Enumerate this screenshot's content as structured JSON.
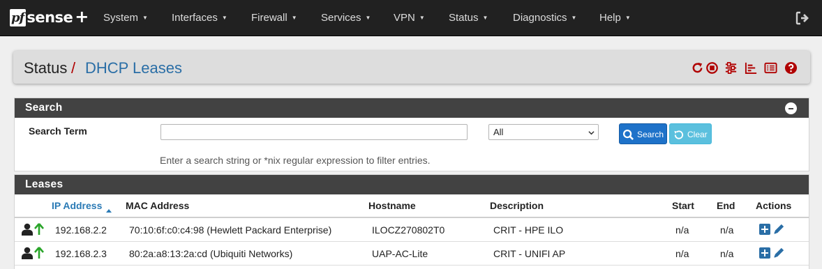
{
  "brand": {
    "logo_pf": "pf",
    "logo_sense": "sense",
    "logo_plus": "+"
  },
  "nav": {
    "menus": [
      {
        "label": "System"
      },
      {
        "label": "Interfaces"
      },
      {
        "label": "Firewall"
      },
      {
        "label": "Services"
      },
      {
        "label": "VPN"
      },
      {
        "label": "Status"
      },
      {
        "label": "Diagnostics"
      },
      {
        "label": "Help"
      }
    ],
    "logout_icon": "logout-icon"
  },
  "breadcrumb": {
    "section": "Status",
    "separator": "/",
    "page": "DHCP Leases",
    "icons": [
      "refresh-icon",
      "stop-icon",
      "settings-sliders-icon",
      "chart-icon",
      "log-list-icon",
      "help-icon"
    ]
  },
  "search_panel": {
    "title": "Search",
    "term_label": "Search Term",
    "term_value": "",
    "filter_selected": "All",
    "search_button": "Search",
    "clear_button": "Clear",
    "help_text": "Enter a search string or *nix regular expression to filter entries."
  },
  "leases_panel": {
    "title": "Leases",
    "columns": {
      "ip": "IP Address",
      "mac": "MAC Address",
      "hostname": "Hostname",
      "description": "Description",
      "start": "Start",
      "end": "End",
      "actions": "Actions"
    },
    "rows": [
      {
        "ip": "192.168.2.2",
        "mac": "70:10:6f:c0:c4:98 (Hewlett Packard Enterprise)",
        "hostname": "ILOCZ270802T0",
        "description": "CRIT - HPE ILO",
        "start": "n/a",
        "end": "n/a"
      },
      {
        "ip": "192.168.2.3",
        "mac": "80:2a:a8:13:2a:cd (Ubiquiti Networks)",
        "hostname": "UAP-AC-Lite",
        "description": "CRIT - UNIFI AP",
        "start": "n/a",
        "end": "n/a"
      }
    ]
  },
  "colors": {
    "navbar": "#212121",
    "panel_header": "#424242",
    "accent_red": "#b00000",
    "link_blue": "#2a6ea6",
    "search_button": "#1e72c9",
    "clear_button": "#5bc0de",
    "online_green": "#2aa52a"
  }
}
